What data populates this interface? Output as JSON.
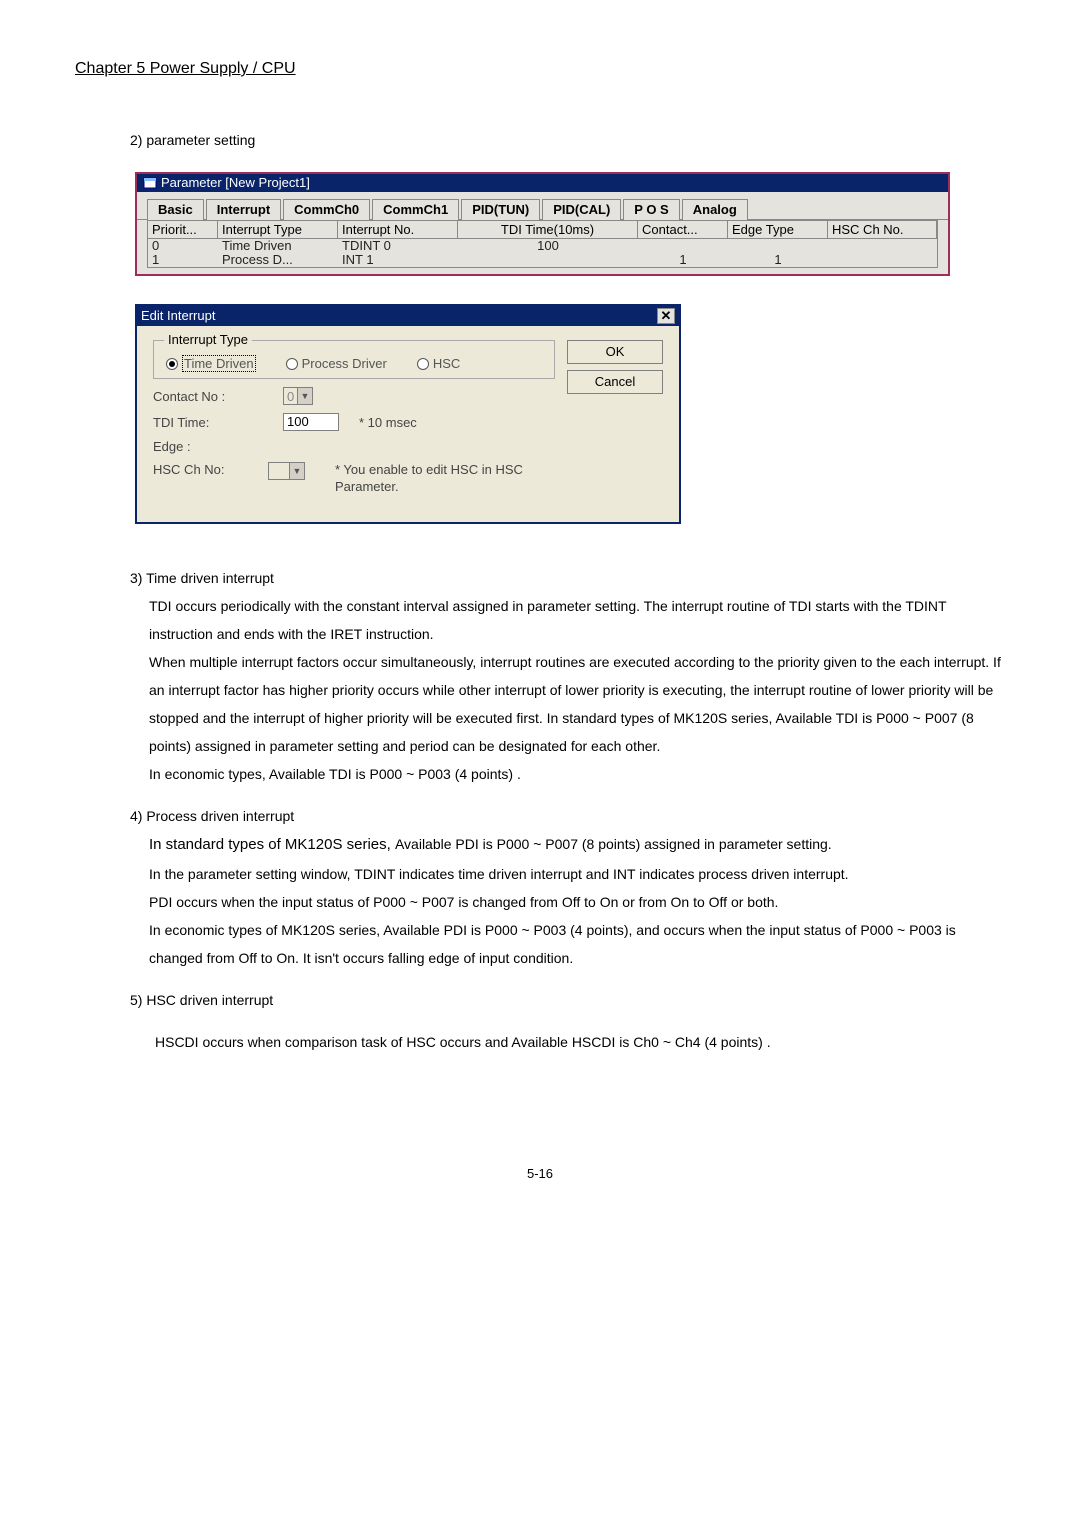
{
  "chapter": "Chapter 5   Power Supply / CPU",
  "section2": "2) parameter setting",
  "param": {
    "title": "Parameter [New Project1]",
    "tabs": [
      "Basic",
      "Interrupt",
      "CommCh0",
      "CommCh1",
      "PID(TUN)",
      "PID(CAL)",
      "P O S",
      "Analog"
    ],
    "cols": [
      "Priorit...",
      "Interrupt Type",
      "Interrupt No.",
      "TDI Time(10ms)",
      "Contact...",
      "Edge Type",
      "HSC Ch No."
    ],
    "rows": [
      {
        "c1": "0",
        "c2": "Time Driven",
        "c3": "TDINT 0",
        "c4": "100",
        "c5": "",
        "c6": "",
        "c7": ""
      },
      {
        "c1": "1",
        "c2": "Process D...",
        "c3": "INT 1",
        "c4": "",
        "c5": "1",
        "c6": "1",
        "c7": ""
      }
    ]
  },
  "dlg": {
    "title": "Edit Interrupt",
    "group": "Interrupt Type",
    "r_time": "Time Driven",
    "r_proc": "Process Driver",
    "r_hsc": "HSC",
    "contact_label": "Contact No :",
    "contact_val": "0",
    "tdi_label": "TDI Time:",
    "tdi_val": "100",
    "tdi_hint": "* 10 msec",
    "edge_label": "Edge :",
    "hscch_label": "HSC Ch No:",
    "hsc_note": "* You enable to edit HSC in HSC Parameter.",
    "ok": "OK",
    "cancel": "Cancel"
  },
  "s3": {
    "title": "3) Time driven interrupt",
    "p1": "TDI occurs periodically with the constant interval assigned in parameter setting. The interrupt routine of TDI starts with the TDINT instruction and ends with the IRET instruction.",
    "p2": "When multiple interrupt factors occur simultaneously, interrupt routines are executed according to the priority given to the each interrupt. If an interrupt factor has higher priority occurs while other interrupt of lower priority is executing, the interrupt routine of lower priority will be stopped and the interrupt of higher priority will be executed first. In standard types of MK120S series, Available TDI is P000 ~ P007 (8 points) assigned in parameter setting and period can be designated for each other.",
    "p3": "In economic types, Available TDI is P000 ~ P003 (4 points) ."
  },
  "s4": {
    "title": "4) Process driven interrupt",
    "l_lead": "In standard types of MK120S series, ",
    "l_rest": "Available PDI is P000 ~ P007 (8 points) assigned in parameter setting.",
    "p2": "In the parameter setting window, TDINT indicates time driven interrupt and INT indicates process driven interrupt.",
    "p3": "PDI occurs when the input status of P000 ~ P007 is changed from Off to On or from On to Off or both.",
    "p4": "In economic types of MK120S series, Available PDI is P000 ~ P003 (4 points), and occurs when the input status of P000 ~ P003 is changed from Off to On. It isn't occurs falling edge of input condition."
  },
  "s5": {
    "title": "5) HSC driven interrupt",
    "p1": "HSCDI occurs when comparison task of HSC occurs and Available HSCDI is Ch0 ~ Ch4 (4 points) ."
  },
  "footer": "5-16"
}
